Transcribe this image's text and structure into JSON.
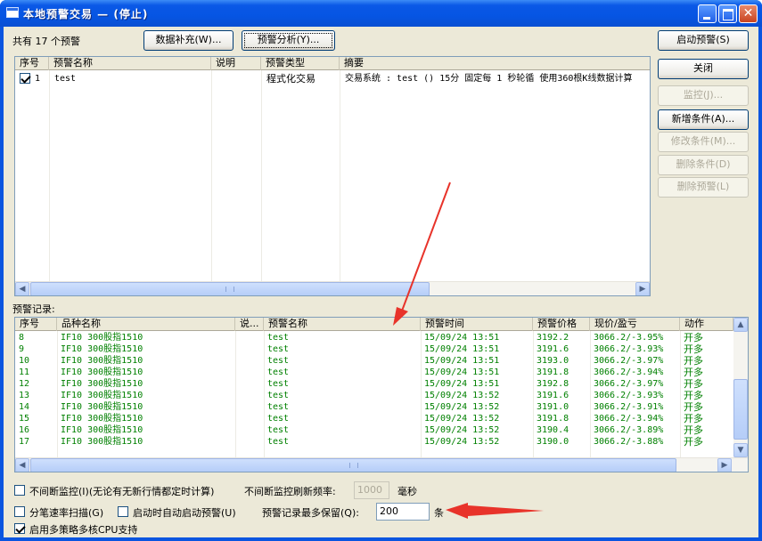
{
  "window": {
    "title": "本地预警交易 — (停止)"
  },
  "top": {
    "count_text": "共有 17 个预警",
    "data_fill_button": "数据补充(W)...",
    "analysis_button": "预警分析(Y)...",
    "start_button": "启动预警(S)"
  },
  "right_buttons": {
    "close": "关闭",
    "monitor": "监控(J)...",
    "add_condition": "新增条件(A)...",
    "modify_condition": "修改条件(M)...",
    "delete_condition": "删除条件(D)",
    "delete_alert": "删除预警(L)"
  },
  "alert_list": {
    "headers": [
      "序号",
      "预警名称",
      "说明",
      "预警类型",
      "摘要"
    ],
    "rows": [
      {
        "no": "1",
        "name": "test",
        "desc": "",
        "type": "程式化交易",
        "summary": "交易系统 : test () 15分 固定每 1 秒轮循 使用360根K线数据计算"
      }
    ]
  },
  "records": {
    "label": "预警记录:",
    "headers": [
      "序号",
      "品种名称",
      "说...",
      "预警名称",
      "预警时间",
      "预警价格",
      "现价/盈亏",
      "动作"
    ],
    "rows": [
      {
        "no": "8",
        "product": "IF10 300股指1510",
        "desc": "",
        "name": "test",
        "time": "15/09/24 13:51",
        "price": "3192.2",
        "pl": "3066.2/-3.95%",
        "action": "开多"
      },
      {
        "no": "9",
        "product": "IF10 300股指1510",
        "desc": "",
        "name": "test",
        "time": "15/09/24 13:51",
        "price": "3191.6",
        "pl": "3066.2/-3.93%",
        "action": "开多"
      },
      {
        "no": "10",
        "product": "IF10 300股指1510",
        "desc": "",
        "name": "test",
        "time": "15/09/24 13:51",
        "price": "3193.0",
        "pl": "3066.2/-3.97%",
        "action": "开多"
      },
      {
        "no": "11",
        "product": "IF10 300股指1510",
        "desc": "",
        "name": "test",
        "time": "15/09/24 13:51",
        "price": "3191.8",
        "pl": "3066.2/-3.94%",
        "action": "开多"
      },
      {
        "no": "12",
        "product": "IF10 300股指1510",
        "desc": "",
        "name": "test",
        "time": "15/09/24 13:51",
        "price": "3192.8",
        "pl": "3066.2/-3.97%",
        "action": "开多"
      },
      {
        "no": "13",
        "product": "IF10 300股指1510",
        "desc": "",
        "name": "test",
        "time": "15/09/24 13:52",
        "price": "3191.6",
        "pl": "3066.2/-3.93%",
        "action": "开多"
      },
      {
        "no": "14",
        "product": "IF10 300股指1510",
        "desc": "",
        "name": "test",
        "time": "15/09/24 13:52",
        "price": "3191.0",
        "pl": "3066.2/-3.91%",
        "action": "开多"
      },
      {
        "no": "15",
        "product": "IF10 300股指1510",
        "desc": "",
        "name": "test",
        "time": "15/09/24 13:52",
        "price": "3191.8",
        "pl": "3066.2/-3.94%",
        "action": "开多"
      },
      {
        "no": "16",
        "product": "IF10 300股指1510",
        "desc": "",
        "name": "test",
        "time": "15/09/24 13:52",
        "price": "3190.4",
        "pl": "3066.2/-3.89%",
        "action": "开多"
      },
      {
        "no": "17",
        "product": "IF10 300股指1510",
        "desc": "",
        "name": "test",
        "time": "15/09/24 13:52",
        "price": "3190.0",
        "pl": "3066.2/-3.88%",
        "action": "开多"
      }
    ]
  },
  "options": {
    "continuous_monitor": "不间断监控(I)(无论有无新行情都定时计算)",
    "refresh_label": "不间断监控刷新频率:",
    "refresh_value": "1000",
    "refresh_unit": "毫秒",
    "tick_scan": "分笔速率扫描(G)",
    "auto_start": "启动时自动启动预警(U)",
    "keep_label": "预警记录最多保留(Q):",
    "keep_value": "200",
    "keep_unit": "条",
    "multi_cpu": "启用多策略多核CPU支持"
  },
  "colors": {
    "record_text": "#008000",
    "arrow": "#e8332a",
    "titlebar": "#0a55e0"
  }
}
